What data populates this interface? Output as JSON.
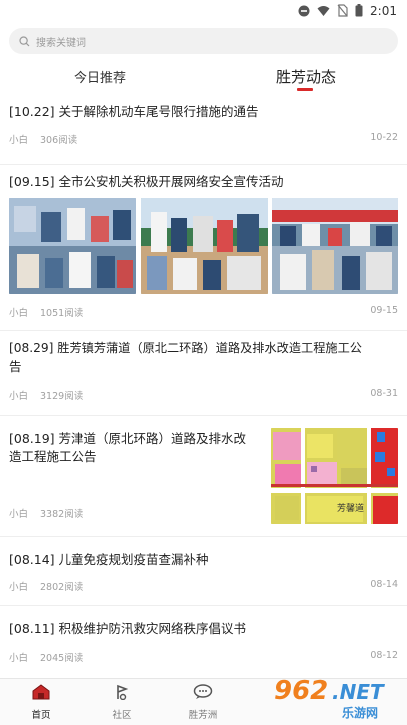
{
  "status_bar": {
    "time": "2:01"
  },
  "search": {
    "placeholder": "搜索关键词"
  },
  "tabs": [
    {
      "label": "今日推荐",
      "active": false
    },
    {
      "label": "胜芳动态",
      "active": true
    }
  ],
  "accent_color": "#d92a2a",
  "feed": [
    {
      "title": "[10.22] 关于解除机动车尾号限行措施的通告",
      "author": "小白",
      "reads": "306阅读",
      "date": "10-22"
    },
    {
      "title": "[09.15] 全市公安机关积极开展网络安全宣传活动",
      "author": "小白",
      "reads": "1051阅读",
      "date": "09-15"
    },
    {
      "title_line1": "[08.29] 胜芳镇芳蒲道（原北二环路）道路及排水改造工程施工公",
      "title_line2": "告",
      "author": "小白",
      "reads": "3129阅读",
      "date": "08-31"
    },
    {
      "title_line1": "[08.19] 芳津道（原北环路）道路及排水改",
      "title_line2": "造工程施工公告",
      "author": "小白",
      "reads": "3382阅读",
      "map_label": "芳馨道"
    },
    {
      "title": "[08.14] 儿童免疫规划疫苗查漏补种",
      "author": "小白",
      "reads": "2802阅读",
      "date": "08-14"
    },
    {
      "title": "[08.11] 积极维护防汛救灾网络秩序倡议书",
      "author": "小白",
      "reads": "2045阅读",
      "date": "08-12"
    }
  ],
  "bottom_nav": [
    {
      "label": "首页",
      "icon": "home-icon",
      "active": true
    },
    {
      "label": "社区",
      "icon": "community-icon",
      "active": false
    },
    {
      "label": "胜芳洲",
      "icon": "chat-icon",
      "active": false
    }
  ],
  "watermark": {
    "brand": "962",
    "suffix": ".NET",
    "sub": "乐游网"
  }
}
